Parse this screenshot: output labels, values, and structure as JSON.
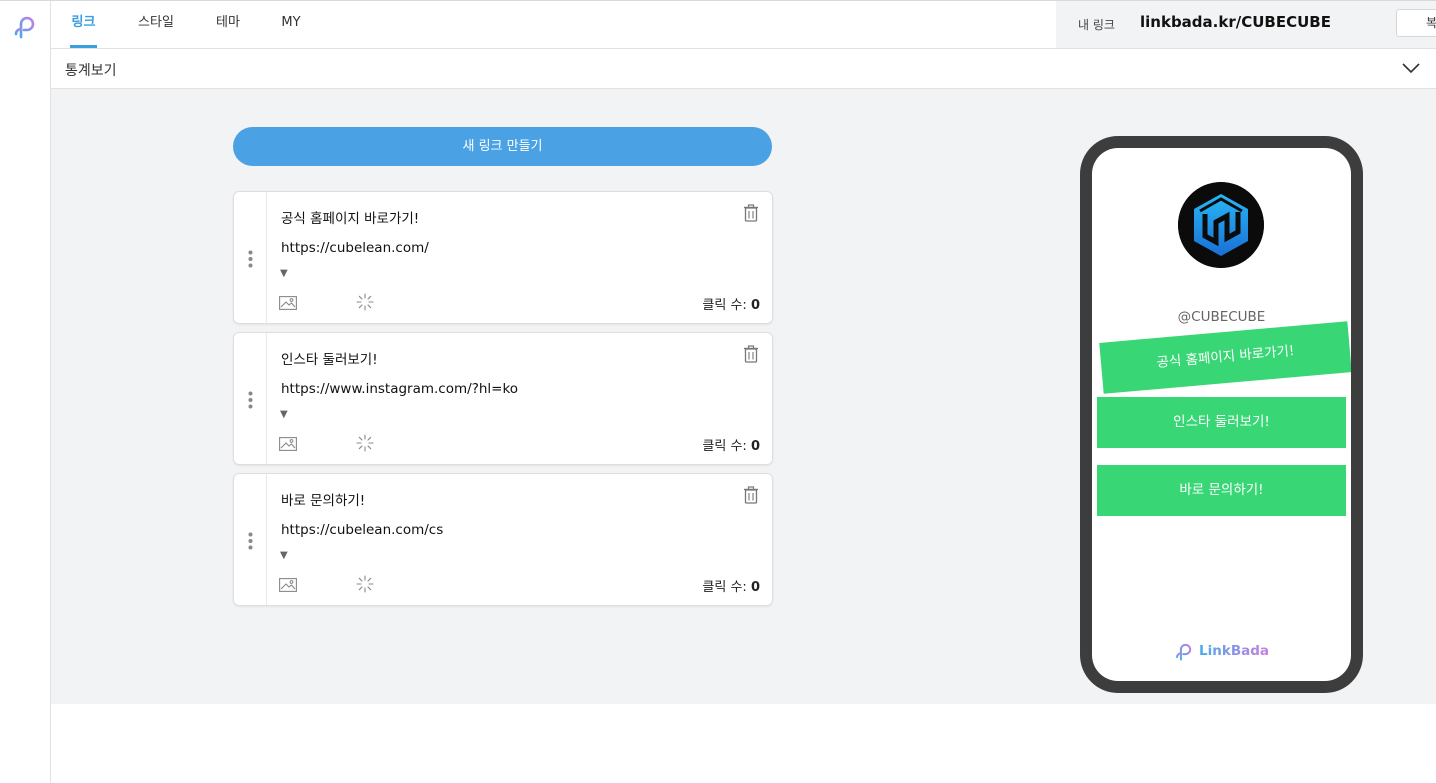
{
  "nav": {
    "tabs": [
      {
        "label": "링크",
        "active": true
      },
      {
        "label": "스타일",
        "active": false
      },
      {
        "label": "테마",
        "active": false
      },
      {
        "label": "MY",
        "active": false
      }
    ]
  },
  "my_link": {
    "label": "내 링크",
    "url": "linkbada.kr/CUBECUBE",
    "copy_label": "복사"
  },
  "stats": {
    "label": "통계보기"
  },
  "editor": {
    "new_link_label": "새 링크 만들기",
    "click_label": "클릭 수:",
    "links": [
      {
        "title": "공식 홈페이지 바로가기!",
        "url": "https://cubelean.com/",
        "clicks": "0"
      },
      {
        "title": "인스타 둘러보기!",
        "url": "https://www.instagram.com/?hl=ko",
        "clicks": "0"
      },
      {
        "title": "바로 문의하기!",
        "url": "https://cubelean.com/cs",
        "clicks": "0"
      }
    ],
    "expand_glyph": "▼"
  },
  "preview": {
    "handle": "@CUBECUBE",
    "buttons": [
      "공식 홈페이지 바로가기!",
      "인스타 둘러보기!",
      "바로 문의하기!"
    ],
    "brand": "LinkBada",
    "button_color": "#38d675"
  },
  "colors": {
    "accent": "#3b9ee0",
    "primary_button": "#4aa1e3",
    "phone_frame": "#3d3d3d"
  }
}
